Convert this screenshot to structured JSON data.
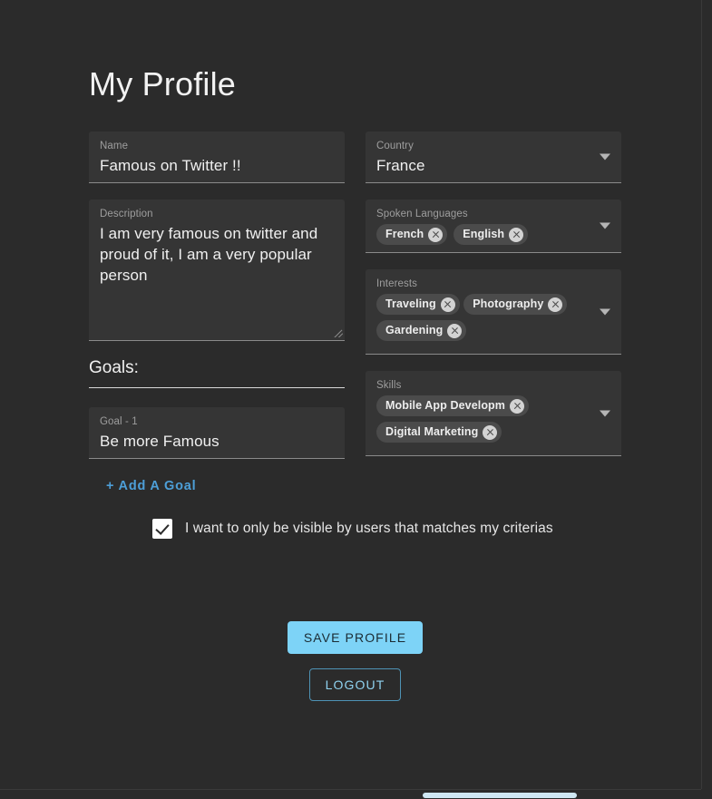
{
  "page": {
    "title": "My Profile",
    "background_color": "#2b2b2b",
    "accent_color": "#7dd3f7",
    "link_color": "#4d9fd8"
  },
  "left_column": {
    "name_field": {
      "label": "Name",
      "value": "Famous on Twitter !!"
    },
    "description_field": {
      "label": "Description",
      "value": "I am very famous on twitter and proud of it, I am a very popular person"
    },
    "goals_heading": "Goals:",
    "goals": [
      {
        "label": "Goal - 1",
        "value": "Be more Famous"
      }
    ],
    "add_goal_label": "+ Add A Goal"
  },
  "right_column": {
    "country_field": {
      "label": "Country",
      "value": "France",
      "icon": "chevron-down-icon"
    },
    "spoken_languages_field": {
      "label": "Spoken Languages",
      "icon": "chevron-down-icon",
      "chips": [
        "French",
        "English"
      ]
    },
    "interests_field": {
      "label": "Interests",
      "icon": "chevron-down-icon",
      "chips": [
        "Traveling",
        "Photography",
        "Gardening"
      ]
    },
    "skills_field": {
      "label": "Skills",
      "icon": "chevron-down-icon",
      "chips": [
        "Mobile App Development",
        "Digital Marketing"
      ]
    }
  },
  "visibility_checkbox": {
    "checked": true,
    "label": "I want to only be visible by users that matches my criterias"
  },
  "actions": {
    "save_label": "SAVE PROFILE",
    "logout_label": "LOGOUT"
  }
}
